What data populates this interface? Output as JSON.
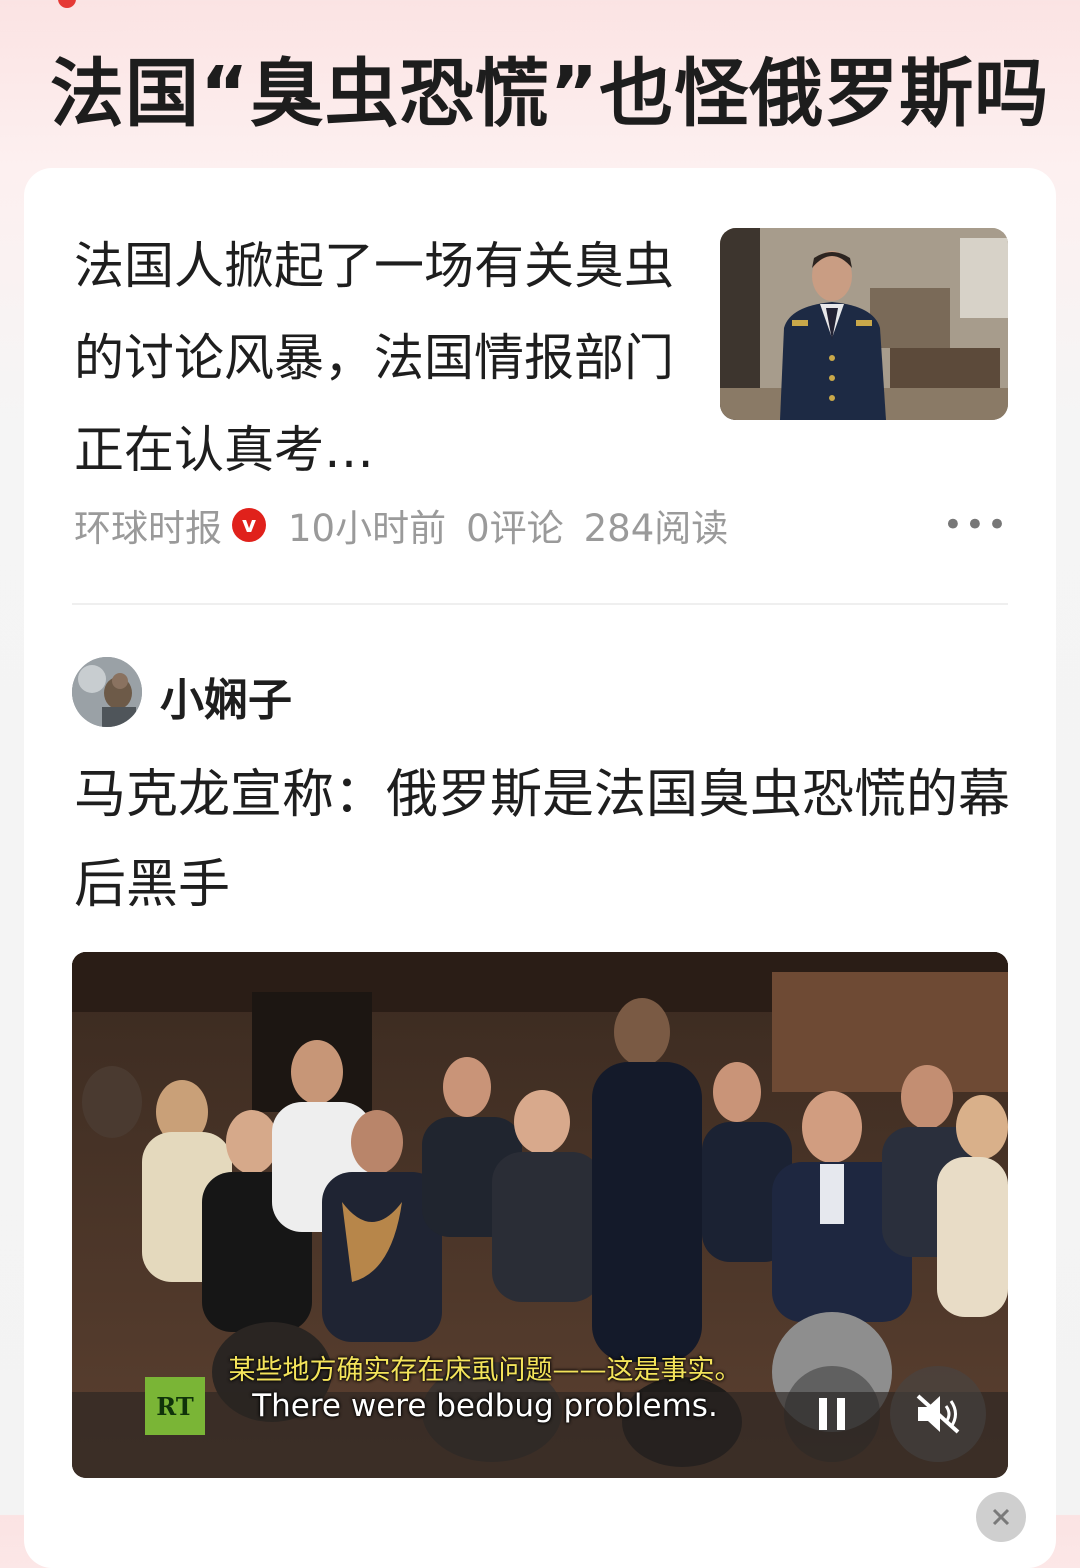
{
  "topic": {
    "title": "法国“臭虫恐慌”也怪俄罗斯吗"
  },
  "news": {
    "summary": "法国人掀起了一场有关臭虫的讨论风暴，法国情报部门正在认真考…",
    "source": "环球时报",
    "verified_badge": "v",
    "time": "10小时前",
    "comments": "0评论",
    "reads": "284阅读",
    "more_icon": "more-horizontal-icon"
  },
  "post": {
    "author": "小娴子",
    "title": "马克龙宣称：俄罗斯是法国臭虫恐慌的幕后黑手",
    "video": {
      "subtitle_cn": "某些地方确实存在床虱问题——这是事实。",
      "subtitle_en": "There were bedbug problems.",
      "channel_logo": "RT",
      "state": "playing",
      "muted": true
    }
  },
  "colors": {
    "accent_red": "#e0211b",
    "meta_gray": "#9a9a9a",
    "rt_green": "#7ab536",
    "subtitle_yellow": "#f3e35a"
  }
}
